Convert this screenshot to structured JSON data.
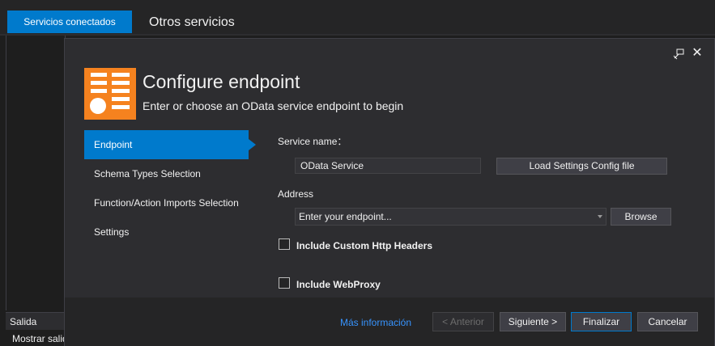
{
  "background": {
    "tabs": [
      "Servicios conectados",
      "Otros servicios"
    ],
    "output_title": "Salida",
    "output_line": "Mostrar salida"
  },
  "dialog": {
    "title": "Configure endpoint",
    "subtitle": "Enter or choose an OData service endpoint to begin",
    "nav": [
      {
        "label": "Endpoint",
        "active": true
      },
      {
        "label": "Schema Types Selection",
        "active": false
      },
      {
        "label": "Function/Action Imports Selection",
        "active": false
      },
      {
        "label": "Settings",
        "active": false
      }
    ],
    "service_name_label": "Service name：",
    "service_name_value": "OData Service",
    "load_settings_button": "Load Settings Config file",
    "address_label": "Address",
    "address_placeholder": "Enter your endpoint...",
    "browse_button": "Browse",
    "include_headers_label": "Include Custom Http Headers",
    "include_headers_checked": false,
    "include_webproxy_label": "Include WebProxy",
    "include_webproxy_checked": false,
    "footer": {
      "more_info": "Más información",
      "previous": "< Anterior",
      "next": "Siguiente >",
      "finish": "Finalizar",
      "cancel": "Cancelar"
    }
  },
  "colors": {
    "accent": "#007acc",
    "logo": "#f5821f",
    "link": "#3794ff"
  },
  "icons": [
    "pin-icon",
    "close-icon",
    "combo-chevron-icon",
    "odata-logo-icon"
  ]
}
